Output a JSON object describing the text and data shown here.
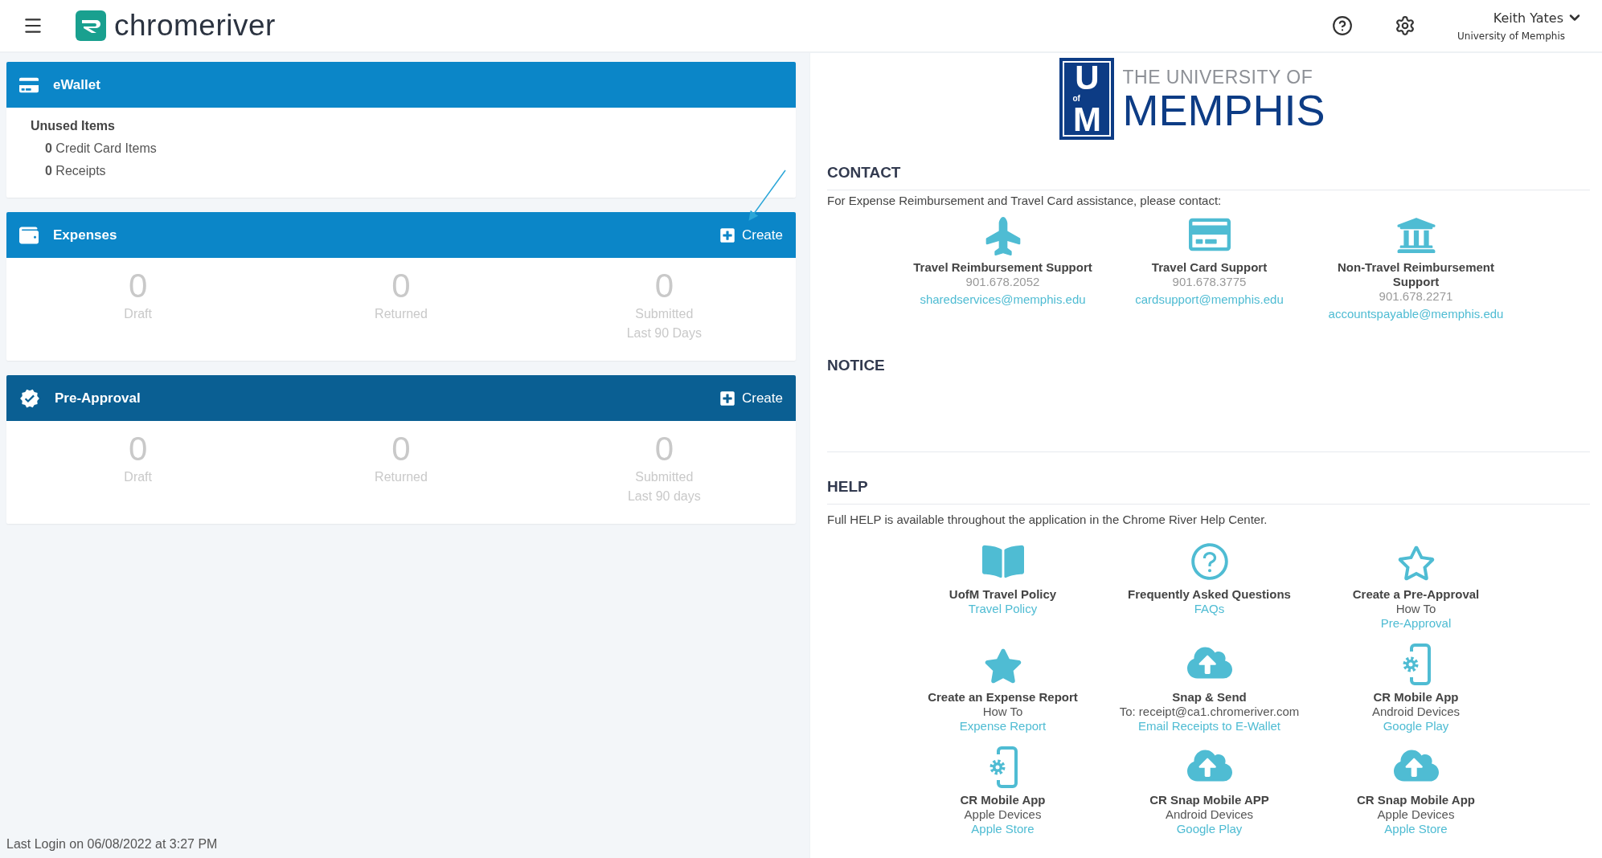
{
  "header": {
    "brand": "chromeriver",
    "user": {
      "name": "Keith Yates",
      "organization": "University of Memphis"
    }
  },
  "panels": [
    {
      "kind": "summary",
      "title": "eWallet",
      "color": "#0b86c8",
      "heading": "Unused Items",
      "items": [
        {
          "count": "0",
          "label": "Credit Card Items"
        },
        {
          "count": "0",
          "label": "Receipts"
        }
      ]
    },
    {
      "kind": "stats",
      "title": "Expenses",
      "color": "#0b86c8",
      "action": "Create",
      "stats": [
        {
          "value": "0",
          "label": "Draft"
        },
        {
          "value": "0",
          "label": "Returned"
        },
        {
          "value": "0",
          "label": "Submitted",
          "note": "Last 90 Days"
        }
      ]
    },
    {
      "kind": "stats",
      "title": "Pre-Approval",
      "color": "#0a5f93",
      "action": "Create",
      "stats": [
        {
          "value": "0",
          "label": "Draft"
        },
        {
          "value": "0",
          "label": "Returned"
        },
        {
          "value": "0",
          "label": "Submitted",
          "note": "Last 90 days"
        }
      ]
    }
  ],
  "last_login": "Last Login on 06/08/2022 at 3:27 PM",
  "logo": {
    "mark_top": "U",
    "mark_small": "of",
    "mark_bottom": "M",
    "line1": "THE UNIVERSITY OF",
    "line2": "MEMPHIS"
  },
  "contact": {
    "title": "CONTACT",
    "intro": "For Expense Reimbursement and Travel Card assistance, please contact:",
    "items": [
      {
        "name": "Travel Reimbursement Support",
        "phone": "901.678.2052",
        "email": "sharedservices@memphis.edu"
      },
      {
        "name": "Travel Card Support",
        "phone": "901.678.3775",
        "email": "cardsupport@memphis.edu"
      },
      {
        "name": "Non-Travel Reimbursement Support",
        "phone": "901.678.2271",
        "email": "accountspayable@memphis.edu"
      }
    ]
  },
  "notice": {
    "title": "NOTICE"
  },
  "help": {
    "title": "HELP",
    "intro": "Full HELP is available throughout the application in the Chrome River Help Center.",
    "items": [
      {
        "title": "UofM Travel Policy",
        "link": "Travel Policy"
      },
      {
        "title": "Frequently Asked Questions",
        "link": "FAQs"
      },
      {
        "title": "Create a Pre-Approval",
        "subtitle": "How To",
        "link": "Pre-Approval"
      },
      {
        "title": "Create an Expense Report",
        "subtitle": "How To",
        "link": "Expense Report"
      },
      {
        "title": "Snap & Send",
        "subtitle": "To: receipt@ca1.chromeriver.com",
        "link": "Email Receipts to E-Wallet"
      },
      {
        "title": "CR Mobile App",
        "subtitle": "Android Devices",
        "link": "Google Play"
      },
      {
        "title": "CR Mobile App",
        "subtitle": "Apple Devices",
        "link": "Apple Store"
      },
      {
        "title": "CR Snap Mobile APP",
        "subtitle": "Android Devices",
        "link": "Google Play"
      },
      {
        "title": "CR Snap Mobile App",
        "subtitle": "Apple Devices",
        "link": "Apple Store"
      }
    ]
  }
}
